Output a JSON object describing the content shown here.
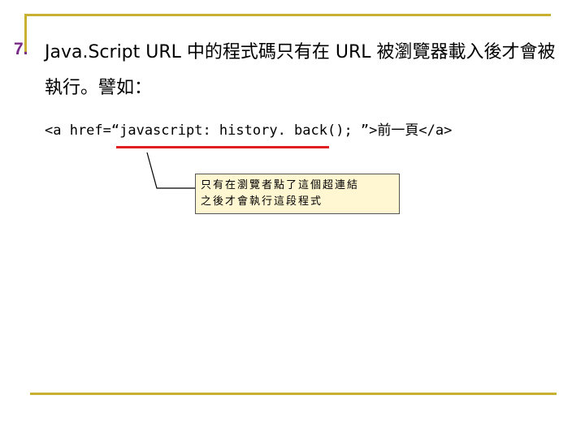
{
  "slide": {
    "bullet_number": "7.",
    "heading": "Java.Script URL 中的程式碼只有在 URL 被瀏覽器載入後才會被執行。譬如：",
    "code": "<a href=“javascript: history. back(); ”>前一頁</a>",
    "note_line1": "只有在瀏覽者點了這個超連結",
    "note_line2": "之後才會執行這段程式"
  },
  "colors": {
    "accent_bar": "#c8b030",
    "bullet": "#7a2a88",
    "underline": "#e02020",
    "note_background": "#fff7d2"
  }
}
